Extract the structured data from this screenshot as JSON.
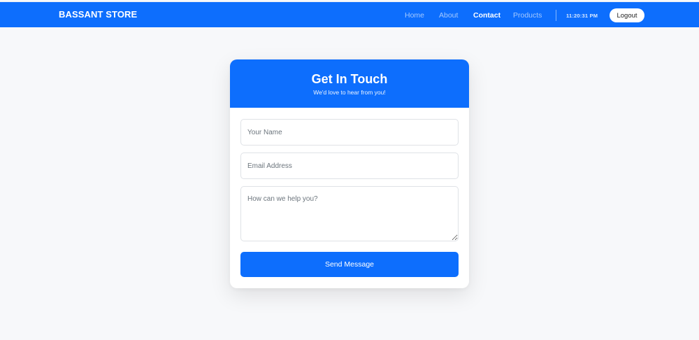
{
  "navbar": {
    "brand": "BASSANT STORE",
    "links": [
      {
        "label": "Home",
        "active": false
      },
      {
        "label": "About",
        "active": false
      },
      {
        "label": "Contact",
        "active": true
      },
      {
        "label": "Products",
        "active": false
      }
    ],
    "clock": "11:20:31 PM",
    "logout_label": "Logout"
  },
  "contact": {
    "title": "Get In Touch",
    "subtitle": "We'd love to hear from you!",
    "name_placeholder": "Your Name",
    "email_placeholder": "Email Address",
    "message_placeholder": "How can we help you?",
    "send_label": "Send Message"
  },
  "colors": {
    "primary": "#0d6efd",
    "page_background": "#f7f8fa",
    "card_background": "#ffffff"
  }
}
